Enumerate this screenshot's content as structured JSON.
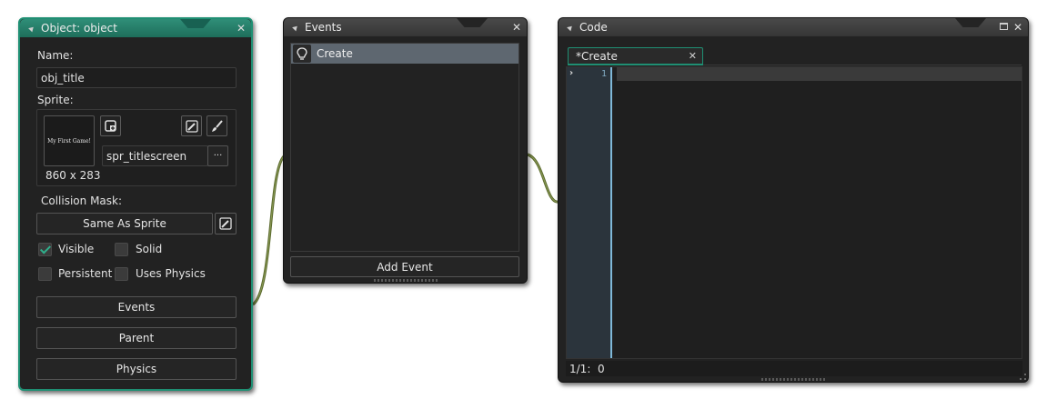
{
  "object_panel": {
    "title": "Object: object",
    "name_label": "Name:",
    "name_value": "obj_title",
    "sprite_label": "Sprite:",
    "sprite_preview_text": "My First Game!",
    "sprite_dimensions": "860 x 283",
    "sprite_value": "spr_titlescreen",
    "sprite_more": "···",
    "collision_label": "Collision Mask:",
    "collision_button": "Same As Sprite",
    "checkboxes": [
      {
        "label": "Visible",
        "checked": true
      },
      {
        "label": "Solid",
        "checked": false
      },
      {
        "label": "Persistent",
        "checked": false
      },
      {
        "label": "Uses Physics",
        "checked": false
      }
    ],
    "events_button": "Events",
    "parent_button": "Parent",
    "physics_button": "Physics"
  },
  "events_panel": {
    "title": "Events",
    "items": [
      {
        "label": "Create",
        "icon": "lightbulb-icon"
      }
    ],
    "add_event_button": "Add Event"
  },
  "code_panel": {
    "title": "Code",
    "tabs": [
      {
        "label": "*Create"
      }
    ],
    "line_numbers": [
      "1"
    ],
    "status": "1/1:  0"
  },
  "colors": {
    "accent": "#1f8f73",
    "connector": "#6b7a3a",
    "selection": "#5e6770"
  }
}
